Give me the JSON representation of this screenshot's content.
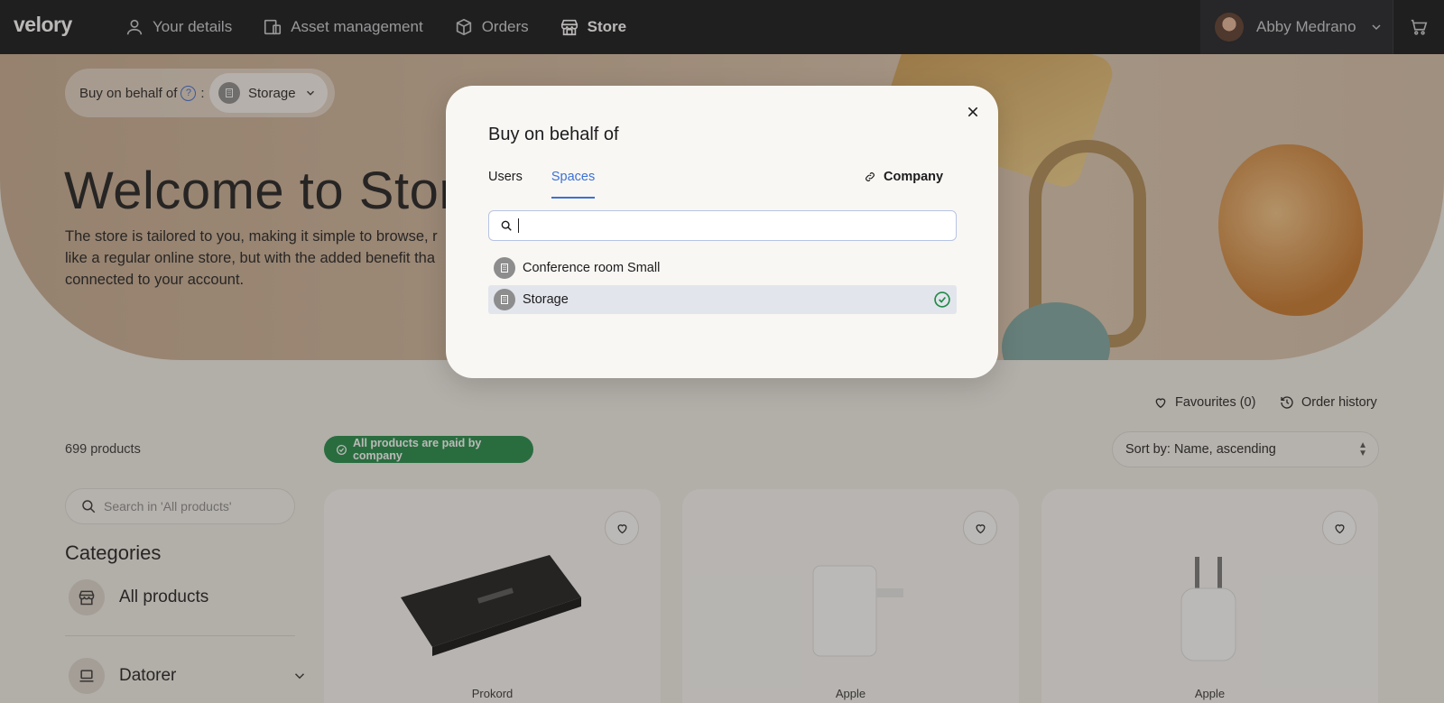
{
  "nav": {
    "logo": "velory",
    "links": [
      {
        "label": "Your details",
        "icon": "user-icon"
      },
      {
        "label": "Asset management",
        "icon": "devices-icon"
      },
      {
        "label": "Orders",
        "icon": "box-icon"
      },
      {
        "label": "Store",
        "icon": "store-icon",
        "active": true
      }
    ],
    "user_name": "Abby Medrano"
  },
  "hero": {
    "behalf_label": "Buy on behalf of",
    "behalf_help": "?",
    "behalf_colon": ":",
    "behalf_value": "Storage",
    "title": "Welcome to Stor",
    "desc_line1": "The store is tailored to you, making it simple to browse, r",
    "desc_line2": "like a regular online store, but with the added benefit tha",
    "desc_line3": "connected to your account."
  },
  "toolbar": {
    "favourites": "Favourites (0)",
    "order_history": "Order history",
    "product_count": "699 products",
    "paid_badge": "All products are paid by company",
    "sort_label": "Sort by: Name, ascending"
  },
  "sidebar": {
    "search_placeholder": "Search in 'All products'",
    "categories_title": "Categories",
    "items": [
      {
        "label": "All products"
      },
      {
        "label": "Datorer"
      }
    ]
  },
  "products": [
    {
      "brand": "Prokord"
    },
    {
      "brand": "Apple"
    },
    {
      "brand": "Apple"
    }
  ],
  "modal": {
    "title": "Buy on behalf of",
    "tabs": [
      "Users",
      "Spaces"
    ],
    "active_tab": "Spaces",
    "company_link": "Company",
    "search_value": "",
    "options": [
      {
        "label": "Conference room Small",
        "selected": false
      },
      {
        "label": "Storage",
        "selected": true
      }
    ]
  },
  "colors": {
    "accent": "#3c71d4",
    "success": "#208a47",
    "nav_bg": "#111318"
  }
}
